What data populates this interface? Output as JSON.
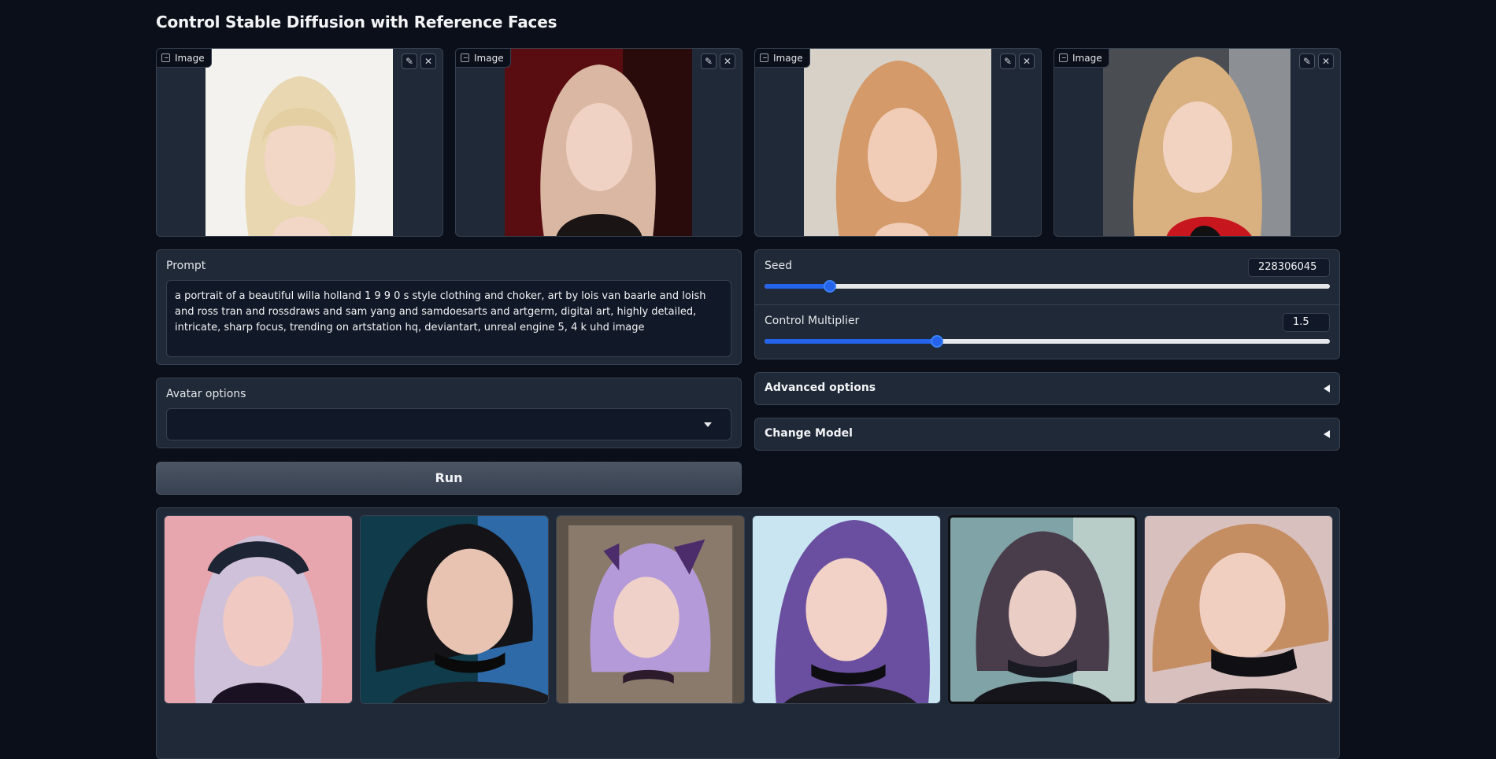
{
  "page": {
    "title": "Control Stable Diffusion with Reference Faces"
  },
  "references": [
    {
      "label": "Image",
      "edit_icon": "pencil-icon",
      "close_icon": "close-icon"
    },
    {
      "label": "Image",
      "edit_icon": "pencil-icon",
      "close_icon": "close-icon"
    },
    {
      "label": "Image",
      "edit_icon": "pencil-icon",
      "close_icon": "close-icon"
    },
    {
      "label": "Image",
      "edit_icon": "pencil-icon",
      "close_icon": "close-icon"
    }
  ],
  "prompt": {
    "label": "Prompt",
    "value": "a portrait of a beautiful willa holland 1 9 9 0 s style clothing and choker, art by lois van baarle and loish and ross tran and rossdraws and sam yang and samdoesarts and artgerm, digital art, highly detailed, intricate, sharp focus, trending on artstation hq, deviantart, unreal engine 5, 4 k uhd image"
  },
  "avatar": {
    "label": "Avatar options",
    "value": ""
  },
  "run": {
    "label": "Run"
  },
  "seed": {
    "label": "Seed",
    "value": "228306045",
    "fraction": 0.115
  },
  "control_multiplier": {
    "label": "Control Multiplier",
    "value": "1.5",
    "fraction": 0.305
  },
  "advanced": {
    "label": "Advanced options"
  },
  "change_model": {
    "label": "Change Model"
  },
  "colors": {
    "accent": "#2563eb",
    "background": "#0b0f19",
    "panel": "#1f2937"
  }
}
